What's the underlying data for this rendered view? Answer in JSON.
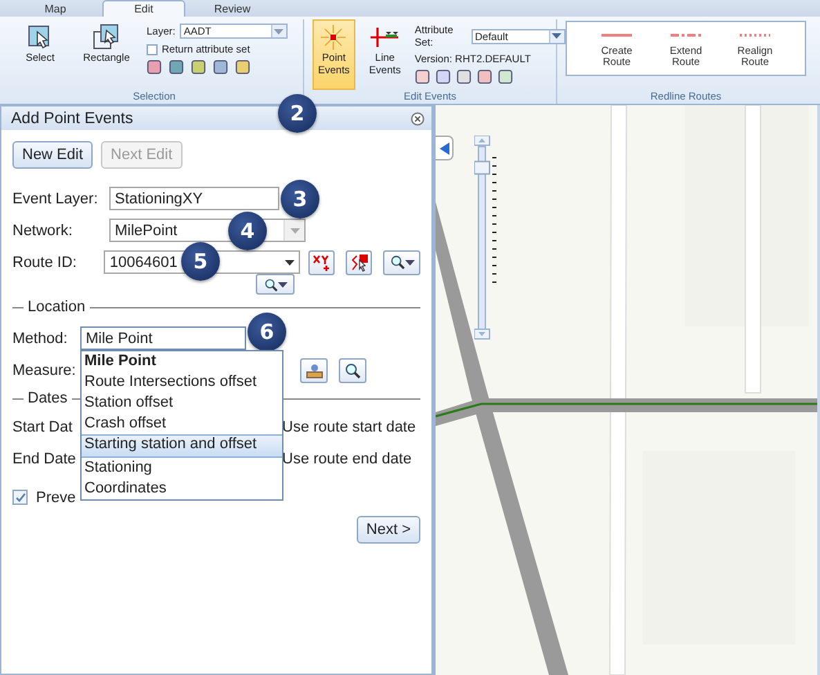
{
  "ribbon": {
    "tabs": [
      {
        "label": "Map",
        "selected": false
      },
      {
        "label": "Edit",
        "selected": true
      },
      {
        "label": "Review",
        "selected": false
      }
    ],
    "selection_group": {
      "title": "Selection",
      "select_label": "Select",
      "rectangle_label": "Rectangle",
      "layer_label": "Layer:",
      "layer_value": "AADT",
      "return_attribute_set": {
        "label": "Return attribute set",
        "checked": false
      }
    },
    "edit_events_group": {
      "title": "Edit Events",
      "tools": [
        {
          "label": "Point Events",
          "selected": true
        },
        {
          "label": "Line Events",
          "selected": false
        }
      ],
      "attribute_set_label": "Attribute Set:",
      "attribute_set_value": "Default",
      "version": "Version: RHT2.DEFAULT"
    },
    "redline_group": {
      "title": "Redline Routes",
      "tools": [
        {
          "label": "Create Route",
          "kind": "solid"
        },
        {
          "label": "Extend Route",
          "kind": "dashed"
        },
        {
          "label": "Realign Route",
          "kind": "dotted"
        }
      ]
    }
  },
  "panel": {
    "title": "Add Point Events",
    "buttons": [
      {
        "label": "New Edit",
        "disabled": false
      },
      {
        "label": "Next Edit",
        "disabled": true
      }
    ],
    "event_layer": {
      "label": "Event Layer:",
      "value": "StationingXY"
    },
    "network": {
      "label": "Network:",
      "value": "MilePoint",
      "disabled": true
    },
    "route_id": {
      "label": "Route ID:",
      "value": "10064601"
    },
    "location": {
      "legend": "Location",
      "method_label": "Method:",
      "method_value": "Mile Point",
      "measure_label": "Measure:",
      "options": [
        {
          "label": "Mile Point",
          "current": true,
          "selected": false
        },
        {
          "label": "Route Intersections offset",
          "current": false,
          "selected": false
        },
        {
          "label": "Station offset",
          "current": false,
          "selected": false
        },
        {
          "label": "Crash offset",
          "current": false,
          "selected": false
        },
        {
          "label": "Starting station and offset",
          "current": false,
          "selected": true
        },
        {
          "label": "Stationing",
          "current": false,
          "selected": false
        },
        {
          "label": "Coordinates",
          "current": false,
          "selected": false
        }
      ]
    },
    "dates": {
      "legend": "Dates",
      "start_label": "Start Dat",
      "start_option": "Use route start date",
      "end_label": "End Date",
      "end_option": "Use route end date"
    },
    "prevent": {
      "label": "Preve",
      "checked": true
    },
    "next_button": "Next >"
  },
  "callouts": [
    "2",
    "3",
    "4",
    "5",
    "6"
  ],
  "map": {
    "kind": "picture",
    "zoom_slider": {
      "level": 0.92
    }
  }
}
